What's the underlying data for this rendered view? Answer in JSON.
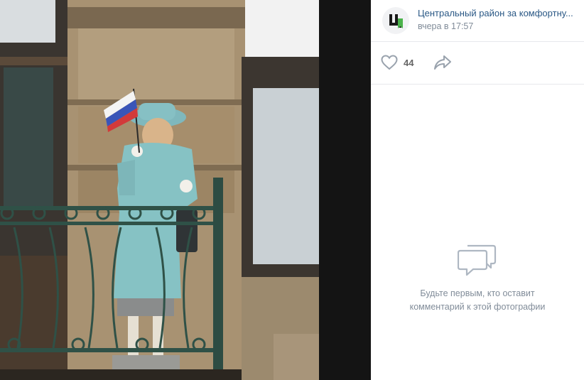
{
  "post": {
    "author": "Центральный район за комфортну...",
    "time": "вчера в 17:57",
    "avatar_letter": "Ц",
    "likes_count": "44"
  },
  "comments": {
    "empty_text": "Будьте первым, кто оставит\nкомментарий к этой фотографии"
  },
  "colors": {
    "link": "#2a5885",
    "muted": "#818c99",
    "accent_green": "#4bb34b",
    "viewer_bg": "#141414"
  },
  "icons": {
    "like": "heart-icon",
    "share": "share-arrow-icon",
    "empty": "comment-bubbles-icon"
  }
}
